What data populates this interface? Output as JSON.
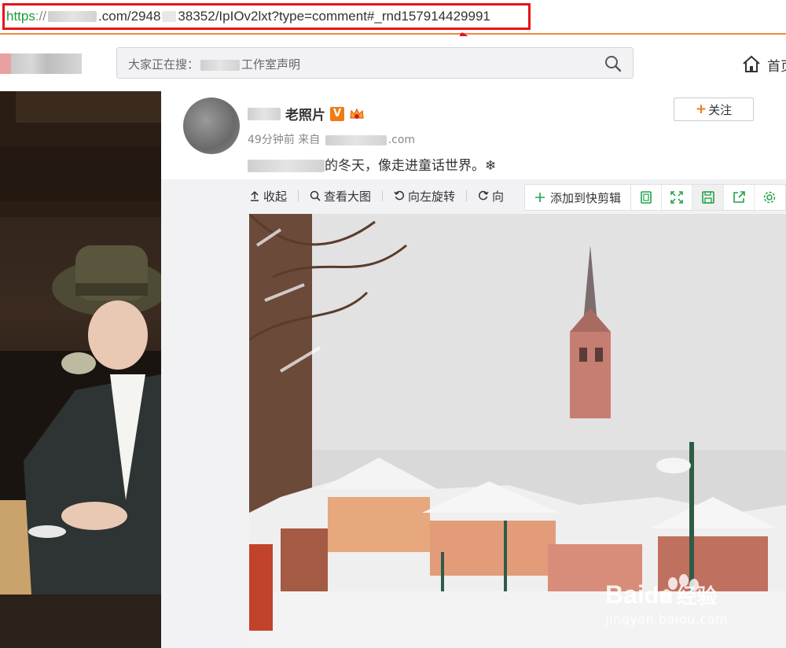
{
  "browser": {
    "url_protocol": "https",
    "url_domain_suffix": ".com/2948",
    "url_path": "38352/IpIOv2lxt?type=comment#_rnd157914429991"
  },
  "header": {
    "search_placeholder": "大家正在搜：",
    "search_suffix": "工作室声明",
    "home_label": "首页"
  },
  "post": {
    "username_suffix": "老照片",
    "verified_badge": "V",
    "time_source": "49分钟前 来自",
    "source_suffix": ".com",
    "follow_label": "关注",
    "text_suffix": "的冬天，像走进童话世界。❄"
  },
  "media_toolbar": {
    "collapse": "收起",
    "view_large": "查看大图",
    "rotate_left": "向左旋转",
    "rotate_right": "向"
  },
  "quick_bar": {
    "add_label": "添加到快剪辑"
  },
  "watermark": {
    "brand": "Bai",
    "brand_suffix": "经验",
    "domain": "jingyan.baidu.com"
  },
  "colors": {
    "accent_orange": "#f07b16",
    "url_highlight": "#e6141a",
    "green_icon": "#1fa24a"
  }
}
